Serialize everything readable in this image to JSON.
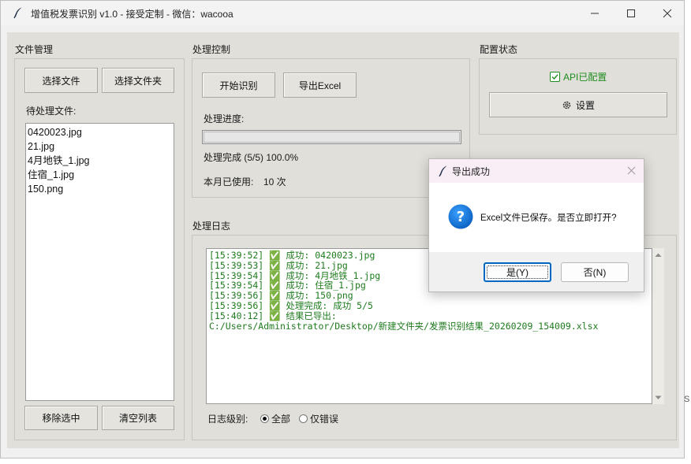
{
  "window": {
    "title": "增值税发票识别 v1.0 - 接受定制 - 微信：wacooa"
  },
  "file_manager": {
    "section_title": "文件管理",
    "select_file_label": "选择文件",
    "select_folder_label": "选择文件夹",
    "pending_label": "待处理文件:",
    "files": [
      "0420023.jpg",
      "21.jpg",
      "4月地铁_1.jpg",
      "住宿_1.jpg",
      "150.png"
    ],
    "remove_selected_label": "移除选中",
    "clear_list_label": "清空列表"
  },
  "processing": {
    "section_title": "处理控制",
    "start_label": "开始识别",
    "export_label": "导出Excel",
    "progress_label": "处理进度:",
    "progress_fraction": 1.0,
    "status_text": "处理完成 (5/5) 100.0%",
    "usage_label": "本月已使用:",
    "usage_value": "10 次"
  },
  "config": {
    "section_title": "配置状态",
    "api_status": "API已配置",
    "settings_label": "设置",
    "status_color": "#1e8c1e"
  },
  "log": {
    "section_title": "处理日志",
    "lines": [
      "[15:39:52] ✅ 成功: 0420023.jpg",
      "[15:39:53] ✅ 成功: 21.jpg",
      "[15:39:54] ✅ 成功: 4月地铁_1.jpg",
      "[15:39:54] ✅ 成功: 住宿_1.jpg",
      "[15:39:56] ✅ 成功: 150.png",
      "[15:39:56] ✅ 处理完成: 成功 5/5",
      "[15:40:12] ✅ 结果已导出:",
      "C:/Users/Administrator/Desktop/新建文件夹/发票识别结果_20260209_154009.xlsx"
    ],
    "level_label": "日志级别:",
    "level_options": [
      "全部",
      "仅错误"
    ],
    "level_selected": "全部",
    "text_color": "#1e7b1e"
  },
  "dialog": {
    "title": "导出成功",
    "message": "Excel文件已保存。是否立即打开?",
    "icon": "question-icon",
    "yes_label": "是(Y)",
    "no_label": "否(N)",
    "accent": "#0067c0"
  },
  "edge_glyph": "S"
}
